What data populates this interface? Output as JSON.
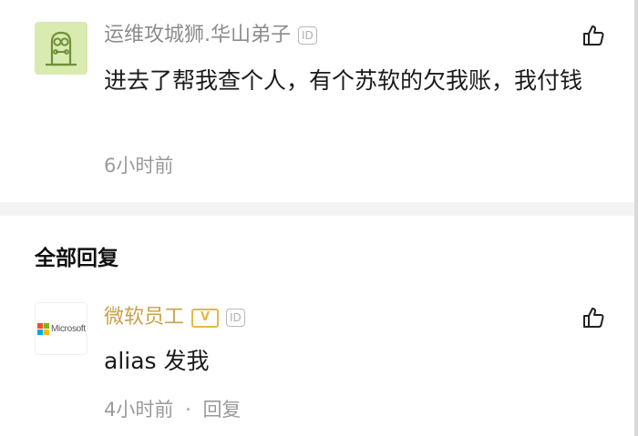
{
  "comment": {
    "author": "运维攻城狮.华山弟子",
    "id_badge": "ID",
    "content": "进去了帮我查个人，有个苏软的欠我账，我付钱",
    "time": "6小时前",
    "avatar_icon": "engineer-robot-avatar",
    "like_icon": "thumbs-up-icon"
  },
  "section": {
    "title": "全部回复"
  },
  "reply": {
    "author": "微软员工",
    "verified_badge": "V",
    "id_badge": "ID",
    "content": "alias 发我",
    "time": "4小时前",
    "separator": "·",
    "reply_label": "回复",
    "avatar_text": "Microsoft",
    "avatar_icon": "microsoft-logo",
    "like_icon": "thumbs-up-icon"
  },
  "colors": {
    "accent_gold": "#c9a24a",
    "meta_grey": "#9a9a9a",
    "avatar_green": "#d9ebb0",
    "divider": "#f4f4f4"
  }
}
